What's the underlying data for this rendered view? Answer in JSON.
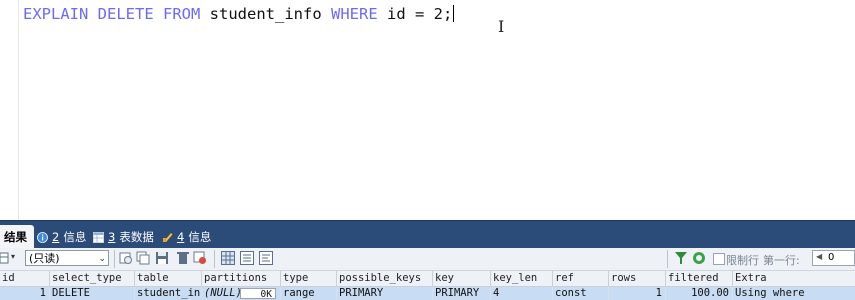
{
  "editor": {
    "tokens": [
      {
        "text": "EXPLAIN",
        "kw": true
      },
      {
        "text": " ",
        "kw": false
      },
      {
        "text": "DELETE",
        "kw": true
      },
      {
        "text": " ",
        "kw": false
      },
      {
        "text": "FROM",
        "kw": true
      },
      {
        "text": " student_info ",
        "kw": false
      },
      {
        "text": "WHERE",
        "kw": true
      },
      {
        "text": " id = 2;",
        "kw": false
      }
    ]
  },
  "tabs": [
    {
      "name": "tab-result",
      "icon": "grid-icon",
      "label": "结果",
      "num": ""
    },
    {
      "name": "tab-info",
      "icon": "info-icon",
      "label": "信息",
      "num": "2"
    },
    {
      "name": "tab-table-data",
      "icon": "table-icon",
      "label": "表数据",
      "num": "3"
    },
    {
      "name": "tab-info-4",
      "icon": "pencil-icon",
      "label": "信息",
      "num": "4"
    }
  ],
  "toolbar": {
    "mode_value": "(只读)",
    "readonly_label": "限制行",
    "first_row_label": "第一行:",
    "first_row_value": "0"
  },
  "grid": {
    "columns": [
      "id",
      "select_type",
      "table",
      "partitions",
      "type",
      "possible_keys",
      "key",
      "key_len",
      "ref",
      "rows",
      "filtered",
      "Extra"
    ],
    "row": {
      "id": "1",
      "select_type": "DELETE",
      "table": "student_inf",
      "partitions": "(NULL)",
      "partitions_size": "0K",
      "type": "range",
      "possible_keys": "PRIMARY",
      "key": "PRIMARY",
      "key_len": "4",
      "ref": "const",
      "rows": "1",
      "filtered": "100.00",
      "Extra": "Using where"
    }
  },
  "colors": {
    "keyword": "#6a6aff",
    "tabbar": "#2b4b78",
    "selected_row": "#c8dcf3"
  }
}
